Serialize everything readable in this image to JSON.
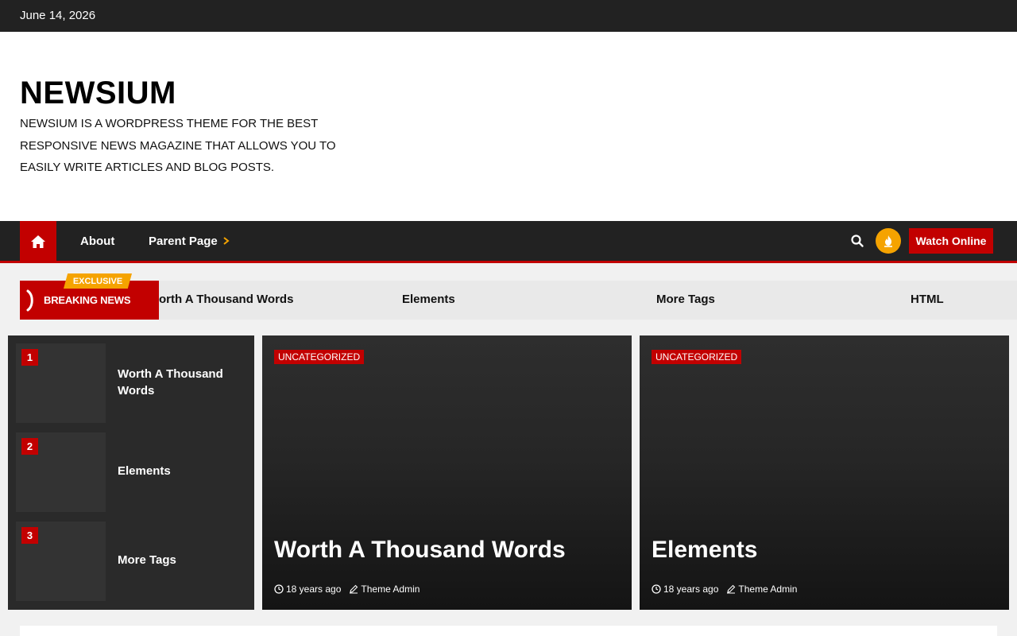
{
  "topbar": {
    "date": "June 14, 2026"
  },
  "header": {
    "title": "NEWSIUM",
    "tagline": "NEWSIUM IS A WORDPRESS THEME FOR THE BEST RESPONSIVE NEWS MAGAZINE THAT ALLOWS YOU TO EASILY WRITE ARTICLES AND BLOG POSTS."
  },
  "nav": {
    "home_icon": "home-icon",
    "items": [
      {
        "label": "About"
      },
      {
        "label": "Parent Page"
      }
    ],
    "search_icon": "search-icon",
    "fire_icon": "fire-icon",
    "watch_label": "Watch Online"
  },
  "ticker": {
    "badge": "EXCLUSIVE",
    "label": "BREAKING NEWS",
    "items": [
      "orth A Thousand Words",
      "Elements",
      "More Tags",
      "HTML"
    ]
  },
  "trending": [
    {
      "num": "1",
      "title": "Worth A Thousand Words"
    },
    {
      "num": "2",
      "title": "Elements"
    },
    {
      "num": "3",
      "title": "More Tags"
    }
  ],
  "featured": [
    {
      "category": "UNCATEGORIZED",
      "title": "Worth A Thousand Words",
      "time": "18 years ago",
      "author": "Theme Admin"
    },
    {
      "category": "UNCATEGORIZED",
      "title": "Elements",
      "time": "18 years ago",
      "author": "Theme Admin"
    }
  ],
  "colors": {
    "accent": "#c20000",
    "dark": "#222222",
    "orange": "#f5a300"
  }
}
